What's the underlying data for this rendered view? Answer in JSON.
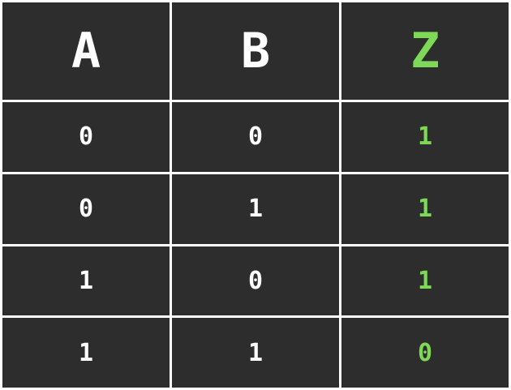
{
  "colors": {
    "cell_background": "#2d2d2d",
    "grid_lines": "#ffffff",
    "input_text": "#ffffff",
    "output_text": "#7ed957"
  },
  "headers": [
    "A",
    "B",
    "Z"
  ],
  "rows": [
    [
      "0",
      "0",
      "1"
    ],
    [
      "0",
      "1",
      "1"
    ],
    [
      "1",
      "0",
      "1"
    ],
    [
      "1",
      "1",
      "0"
    ]
  ]
}
